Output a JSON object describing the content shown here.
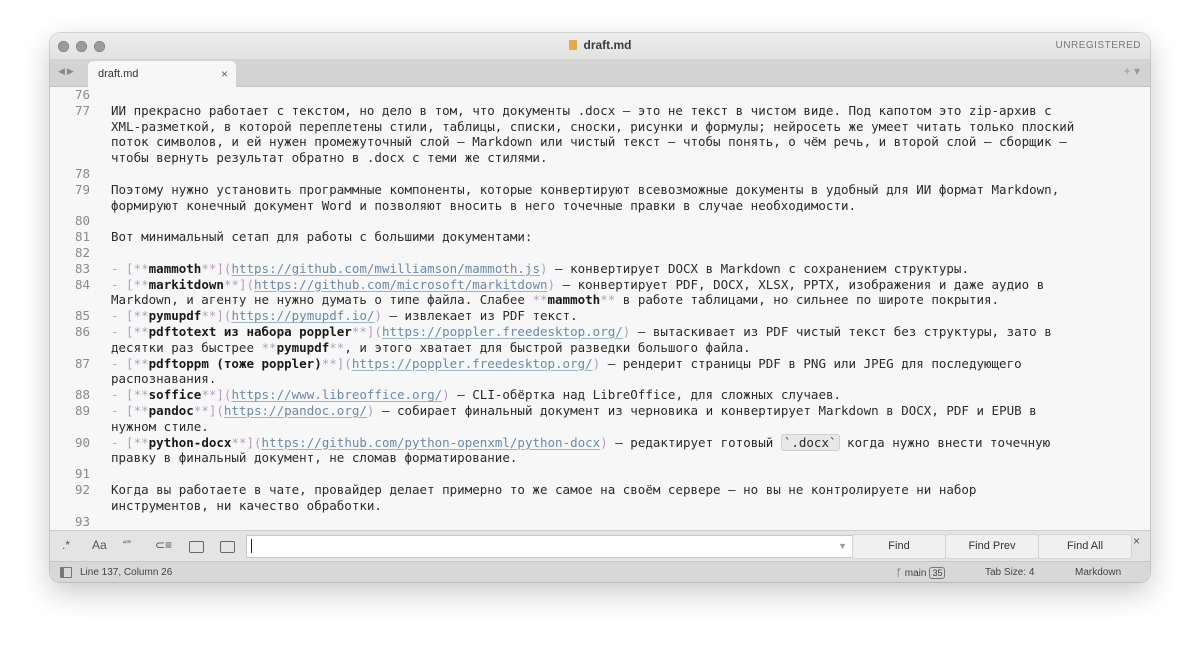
{
  "window": {
    "title": "draft.md",
    "license_label": "UNREGISTERED"
  },
  "tabs": [
    {
      "label": "draft.md",
      "close": "×"
    }
  ],
  "tabbar": {
    "nav_glyph": "◀▶",
    "right_glyph": "+ ▾"
  },
  "editor": {
    "lines": [
      {
        "ln": "76",
        "html": ""
      },
      {
        "ln": "77",
        "html": "ИИ прекрасно работает с текстом, но дело в том, что документы .docx — это не текст в чистом виде. Под капотом это zip-архив с"
      },
      {
        "ln": "",
        "html": "XML-разметкой, в которой переплетены стили, таблицы, списки, сноски, рисунки и формулы; нейросеть же умеет читать только плоский"
      },
      {
        "ln": "",
        "html": "поток символов, и ей нужен промежуточный слой — Markdown или чистый текст — чтобы понять, о чём речь, и второй слой — сборщик —"
      },
      {
        "ln": "",
        "html": "чтобы вернуть результат обратно в .docx с теми же стилями."
      },
      {
        "ln": "78",
        "html": ""
      },
      {
        "ln": "79",
        "html": "Поэтому нужно установить программные компоненты, которые конвертируют всевозможные документы в удобный для ИИ формат Markdown,"
      },
      {
        "ln": "",
        "html": "формируют конечный документ Word и позволяют вносить в него точечные правки в случае необходимости."
      },
      {
        "ln": "80",
        "html": ""
      },
      {
        "ln": "81",
        "html": "Вот минимальный сетап для работы с большими документами:"
      },
      {
        "ln": "82",
        "html": ""
      },
      {
        "ln": "83",
        "html": "<span class='p'>- [**</span><span class='b'>mammoth</span><span class='p'>**](</span><span class='u'>https://github.com/mwilliamson/mammoth.js</span><span class='p'>)</span> — конвертирует DOCX в Markdown с сохранением структуры."
      },
      {
        "ln": "84",
        "html": "<span class='p'>- [**</span><span class='b'>markitdown</span><span class='p'>**](</span><span class='u'>https://github.com/microsoft/markitdown</span><span class='p'>)</span> — конвертирует PDF, DOCX, XLSX, PPTX, изображения и даже аудио в"
      },
      {
        "ln": "",
        "html": "Markdown, и агенту не нужно думать о типе файла. Слабее <span class='p'>**</span><span class='b'>mammoth</span><span class='p'>**</span> в работе таблицами, но сильнее по широте покрытия."
      },
      {
        "ln": "85",
        "html": "<span class='p'>- [**</span><span class='b'>pymupdf</span><span class='p'>**](</span><span class='u'>https://pymupdf.io/</span><span class='p'>)</span> — извлекает из PDF текст."
      },
      {
        "ln": "86",
        "html": "<span class='p'>- [**</span><span class='b'>pdftotext из набора poppler</span><span class='p'>**](</span><span class='u'>https://poppler.freedesktop.org/</span><span class='p'>)</span> — вытаскивает из PDF чистый текст без структуры, зато в"
      },
      {
        "ln": "",
        "html": "десятки раз быстрее <span class='p'>**</span><span class='b'>pymupdf</span><span class='p'>**</span>, и этого хватает для быстрой разведки большого файла."
      },
      {
        "ln": "87",
        "html": "<span class='p'>- [**</span><span class='b'>pdftoppm (тоже poppler)</span><span class='p'>**](</span><span class='u'>https://poppler.freedesktop.org/</span><span class='p'>)</span> — рендерит страницы PDF в PNG или JPEG для последующего"
      },
      {
        "ln": "",
        "html": "распознавания."
      },
      {
        "ln": "88",
        "html": "<span class='p'>- [**</span><span class='b'>soffice</span><span class='p'>**](</span><span class='u'>https://www.libreoffice.org/</span><span class='p'>)</span> — CLI-обёртка над LibreOffice, для сложных случаев."
      },
      {
        "ln": "89",
        "html": "<span class='p'>- [**</span><span class='b'>pandoc</span><span class='p'>**](</span><span class='u'>https://pandoc.org/</span><span class='p'>)</span> — собирает финальный документ из черновика и конвертирует Markdown в DOCX, PDF и EPUB в"
      },
      {
        "ln": "",
        "html": "нужном стиле."
      },
      {
        "ln": "90",
        "html": "<span class='p'>- [**</span><span class='b'>python-docx</span><span class='p'>**](</span><span class='u'>https://github.com/python-openxml/python-docx</span><span class='p'>)</span> — редактирует готовый <span class='code'>`.docx`</span> когда нужно внести точечную"
      },
      {
        "ln": "",
        "html": "правку в финальный документ, не сломав форматирование."
      },
      {
        "ln": "91",
        "html": ""
      },
      {
        "ln": "92",
        "html": "Когда вы работаете в чате, провайдер делает примерно то же самое на своём сервере — но вы не контролируете ни набор"
      },
      {
        "ln": "",
        "html": "инструментов, ни качество обработки."
      },
      {
        "ln": "93",
        "html": ""
      }
    ]
  },
  "find": {
    "opt_regex": ".*",
    "opt_case": "Aa",
    "opt_word": "“”",
    "opt_wrap": "⊂≡",
    "query": "",
    "dropdown_glyph": "▼",
    "find_label": "Find",
    "find_prev_label": "Find Prev",
    "find_all_label": "Find All",
    "close": "×"
  },
  "status": {
    "position": "Line 137, Column 26",
    "branch_glyph": "ᚴ",
    "branch": "main",
    "branch_badge": "35",
    "tab_size": "Tab Size: 4",
    "syntax": "Markdown"
  }
}
